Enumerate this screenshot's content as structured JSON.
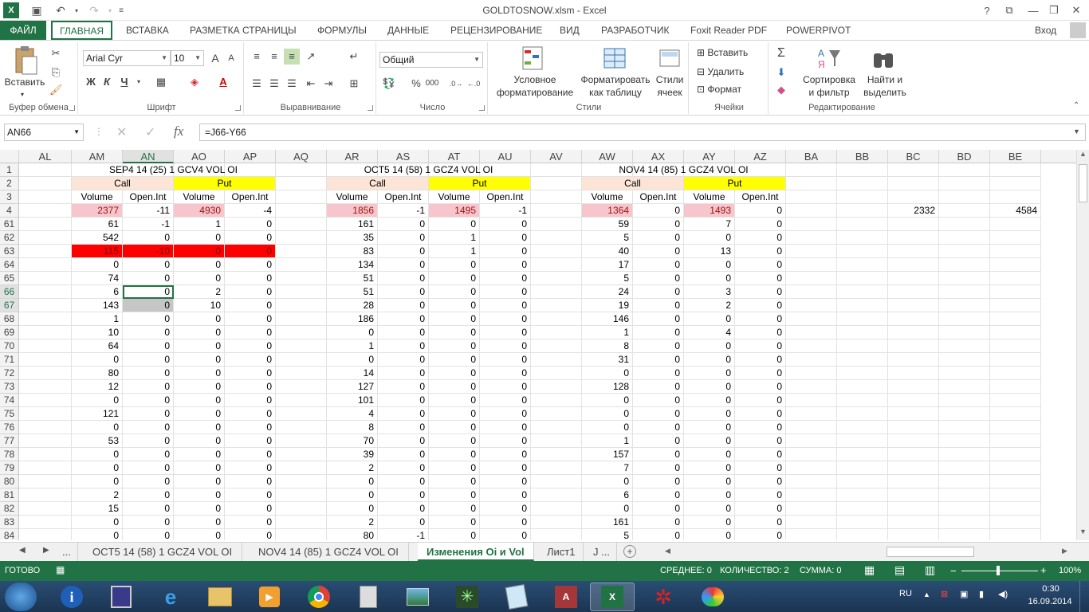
{
  "window": {
    "title": "GOLDTOSNOW.xlsm - Excel",
    "help": "?",
    "user": "Вход"
  },
  "ribbon_tabs": [
    "ФАЙЛ",
    "ГЛАВНАЯ",
    "ВСТАВКА",
    "РАЗМЕТКА СТРАНИЦЫ",
    "ФОРМУЛЫ",
    "ДАННЫЕ",
    "РЕЦЕНЗИРОВАНИЕ",
    "ВИД",
    "РАЗРАБОТЧИК",
    "Foxit Reader PDF",
    "POWERPIVOT"
  ],
  "ribbon": {
    "clipboard": {
      "paste": "Вставить",
      "label": "Буфер обмена"
    },
    "font": {
      "name": "Arial Cyr",
      "size": "10",
      "bold": "Ж",
      "italic": "К",
      "underline": "Ч",
      "label": "Шрифт"
    },
    "alignment": {
      "label": "Выравнивание"
    },
    "number": {
      "format": "Общий",
      "label": "Число"
    },
    "styles": {
      "cond1": "Условное",
      "cond2": "форматирование",
      "table1": "Форматировать",
      "table2": "как таблицу",
      "cell1": "Стили",
      "cell2": "ячеек",
      "label": "Стили"
    },
    "cells": {
      "insert": "Вставить",
      "delete": "Удалить",
      "format": "Формат",
      "label": "Ячейки"
    },
    "editing": {
      "sigma": "Σ",
      "sort1": "Сортировка",
      "sort2": "и фильтр",
      "find1": "Найти и",
      "find2": "выделить",
      "label": "Редактирование"
    }
  },
  "formula_bar": {
    "name_box": "AN66",
    "formula": "=J66-Y66",
    "fx": "fx"
  },
  "columns": [
    "AL",
    "AM",
    "AN",
    "AO",
    "AP",
    "AQ",
    "AR",
    "AS",
    "AT",
    "AU",
    "AV",
    "AW",
    "AX",
    "AY",
    "AZ",
    "BA",
    "BB",
    "BC",
    "BD",
    "BE"
  ],
  "groups": [
    {
      "title": "SEP4 14  (25)  1  GCV4 VOL OI",
      "call": "Call",
      "put": "Put"
    },
    {
      "title": "OCT5 14  (58)  1  GCZ4 VOL OI",
      "call": "Call",
      "put": "Put"
    },
    {
      "title": "NOV4 14  (85)  1  GCZ4 VOL OI",
      "call": "Call",
      "put": "Put"
    }
  ],
  "subheaders": [
    "Volume",
    "Open.Int",
    "Volume",
    "Open.Int"
  ],
  "totals": [
    [
      "2377",
      "-11",
      "4930",
      "-4"
    ],
    [
      "1856",
      "-1",
      "1495",
      "-1"
    ],
    [
      "1364",
      "0",
      "1493",
      "0"
    ]
  ],
  "extra": {
    "bc": "2332",
    "be": "4584"
  },
  "rows": [
    {
      "n": "61",
      "v": [
        [
          "61",
          "-1",
          "1",
          "0"
        ],
        [
          "161",
          "0",
          "0",
          "0"
        ],
        [
          "59",
          "0",
          "7",
          "0"
        ]
      ]
    },
    {
      "n": "62",
      "v": [
        [
          "542",
          "0",
          "0",
          "0"
        ],
        [
          "35",
          "0",
          "1",
          "0"
        ],
        [
          "5",
          "0",
          "0",
          "0"
        ]
      ]
    },
    {
      "n": "63",
      "v": [
        [
          "115",
          "-10",
          "0",
          "0"
        ],
        [
          "83",
          "0",
          "1",
          "0"
        ],
        [
          "40",
          "0",
          "13",
          "0"
        ]
      ]
    },
    {
      "n": "64",
      "v": [
        [
          "0",
          "0",
          "0",
          "0"
        ],
        [
          "134",
          "0",
          "0",
          "0"
        ],
        [
          "17",
          "0",
          "0",
          "0"
        ]
      ]
    },
    {
      "n": "65",
      "v": [
        [
          "74",
          "0",
          "0",
          "0"
        ],
        [
          "51",
          "0",
          "0",
          "0"
        ],
        [
          "5",
          "0",
          "0",
          "0"
        ]
      ]
    },
    {
      "n": "66",
      "v": [
        [
          "6",
          "0",
          "2",
          "0"
        ],
        [
          "51",
          "0",
          "0",
          "0"
        ],
        [
          "24",
          "0",
          "3",
          "0"
        ]
      ]
    },
    {
      "n": "67",
      "v": [
        [
          "143",
          "0",
          "10",
          "0"
        ],
        [
          "28",
          "0",
          "0",
          "0"
        ],
        [
          "19",
          "0",
          "2",
          "0"
        ]
      ]
    },
    {
      "n": "68",
      "v": [
        [
          "1",
          "0",
          "0",
          "0"
        ],
        [
          "186",
          "0",
          "0",
          "0"
        ],
        [
          "146",
          "0",
          "0",
          "0"
        ]
      ]
    },
    {
      "n": "69",
      "v": [
        [
          "10",
          "0",
          "0",
          "0"
        ],
        [
          "0",
          "0",
          "0",
          "0"
        ],
        [
          "1",
          "0",
          "4",
          "0"
        ]
      ]
    },
    {
      "n": "70",
      "v": [
        [
          "64",
          "0",
          "0",
          "0"
        ],
        [
          "1",
          "0",
          "0",
          "0"
        ],
        [
          "8",
          "0",
          "0",
          "0"
        ]
      ]
    },
    {
      "n": "71",
      "v": [
        [
          "0",
          "0",
          "0",
          "0"
        ],
        [
          "0",
          "0",
          "0",
          "0"
        ],
        [
          "31",
          "0",
          "0",
          "0"
        ]
      ]
    },
    {
      "n": "72",
      "v": [
        [
          "80",
          "0",
          "0",
          "0"
        ],
        [
          "14",
          "0",
          "0",
          "0"
        ],
        [
          "0",
          "0",
          "0",
          "0"
        ]
      ]
    },
    {
      "n": "73",
      "v": [
        [
          "12",
          "0",
          "0",
          "0"
        ],
        [
          "127",
          "0",
          "0",
          "0"
        ],
        [
          "128",
          "0",
          "0",
          "0"
        ]
      ]
    },
    {
      "n": "74",
      "v": [
        [
          "0",
          "0",
          "0",
          "0"
        ],
        [
          "101",
          "0",
          "0",
          "0"
        ],
        [
          "0",
          "0",
          "0",
          "0"
        ]
      ]
    },
    {
      "n": "75",
      "v": [
        [
          "121",
          "0",
          "0",
          "0"
        ],
        [
          "4",
          "0",
          "0",
          "0"
        ],
        [
          "0",
          "0",
          "0",
          "0"
        ]
      ]
    },
    {
      "n": "76",
      "v": [
        [
          "0",
          "0",
          "0",
          "0"
        ],
        [
          "8",
          "0",
          "0",
          "0"
        ],
        [
          "0",
          "0",
          "0",
          "0"
        ]
      ]
    },
    {
      "n": "77",
      "v": [
        [
          "53",
          "0",
          "0",
          "0"
        ],
        [
          "70",
          "0",
          "0",
          "0"
        ],
        [
          "1",
          "0",
          "0",
          "0"
        ]
      ]
    },
    {
      "n": "78",
      "v": [
        [
          "0",
          "0",
          "0",
          "0"
        ],
        [
          "39",
          "0",
          "0",
          "0"
        ],
        [
          "157",
          "0",
          "0",
          "0"
        ]
      ]
    },
    {
      "n": "79",
      "v": [
        [
          "0",
          "0",
          "0",
          "0"
        ],
        [
          "2",
          "0",
          "0",
          "0"
        ],
        [
          "7",
          "0",
          "0",
          "0"
        ]
      ]
    },
    {
      "n": "80",
      "v": [
        [
          "0",
          "0",
          "0",
          "0"
        ],
        [
          "0",
          "0",
          "0",
          "0"
        ],
        [
          "0",
          "0",
          "0",
          "0"
        ]
      ]
    },
    {
      "n": "81",
      "v": [
        [
          "2",
          "0",
          "0",
          "0"
        ],
        [
          "0",
          "0",
          "0",
          "0"
        ],
        [
          "6",
          "0",
          "0",
          "0"
        ]
      ]
    },
    {
      "n": "82",
      "v": [
        [
          "15",
          "0",
          "0",
          "0"
        ],
        [
          "0",
          "0",
          "0",
          "0"
        ],
        [
          "0",
          "0",
          "0",
          "0"
        ]
      ]
    },
    {
      "n": "83",
      "v": [
        [
          "0",
          "0",
          "0",
          "0"
        ],
        [
          "2",
          "0",
          "0",
          "0"
        ],
        [
          "161",
          "0",
          "0",
          "0"
        ]
      ]
    },
    {
      "n": "84",
      "v": [
        [
          "0",
          "0",
          "0",
          "0"
        ],
        [
          "80",
          "-1",
          "0",
          "0"
        ],
        [
          "5",
          "0",
          "0",
          "0"
        ]
      ]
    }
  ],
  "sheet_tabs": [
    "...",
    "OCT5 14  (58)  1  GCZ4 VOL OI",
    "NOV4 14  (85)  1  GCZ4 VOL OI",
    "Изменения Oi и Vol",
    "Лист1",
    "J ..."
  ],
  "status": {
    "ready": "ГОТОВО",
    "avg": "СРЕДНЕЕ: 0",
    "count": "КОЛИЧЕСТВО: 2",
    "sum": "СУММА: 0",
    "zoom": "100%"
  },
  "tray": {
    "lang": "RU",
    "time": "0:30",
    "date": "16.09.2014"
  },
  "colors": {
    "accent": "#217346",
    "pink": "#f6c6cc",
    "red": "#ff0000",
    "call": "#fce4d6",
    "put": "#ffff00"
  }
}
